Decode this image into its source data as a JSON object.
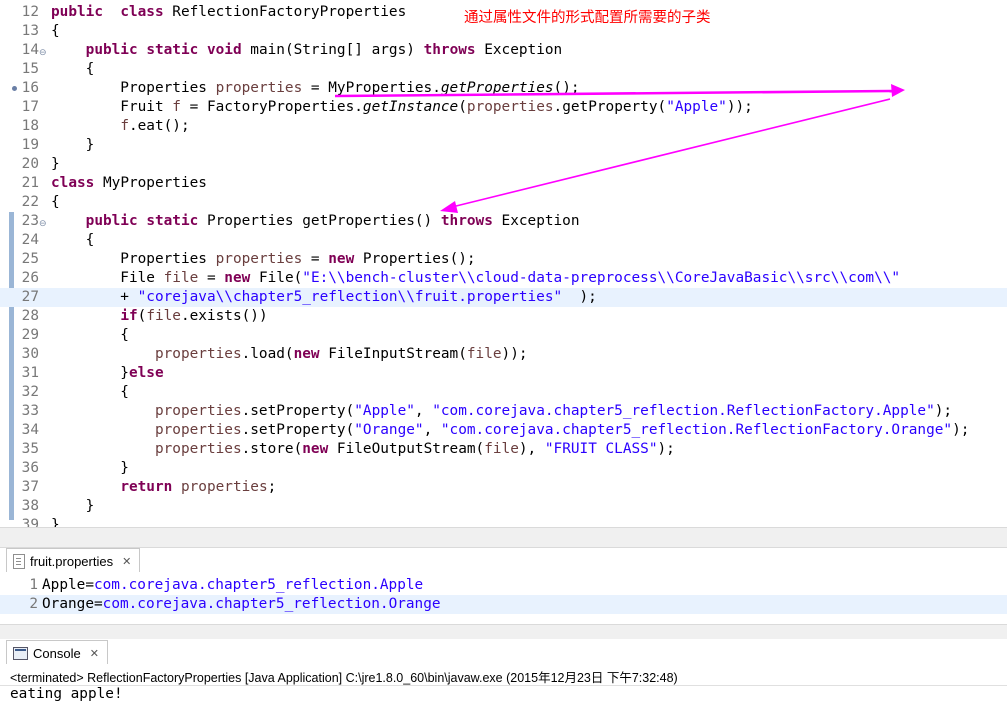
{
  "annotation": "通过属性文件的形式配置所需要的子类",
  "editor": {
    "lines": [
      {
        "num": "12",
        "segs": [
          [
            "kw",
            "public"
          ],
          [
            "",
            "  "
          ],
          [
            "kw",
            "class"
          ],
          [
            "",
            " ReflectionFactoryProperties"
          ]
        ]
      },
      {
        "num": "13",
        "segs": [
          [
            "",
            "{"
          ]
        ]
      },
      {
        "num": "14",
        "fold": true,
        "segs": [
          [
            "",
            "    "
          ],
          [
            "kw",
            "public"
          ],
          [
            "",
            " "
          ],
          [
            "kw",
            "static"
          ],
          [
            "",
            " "
          ],
          [
            "kw",
            "void"
          ],
          [
            "",
            " main(String[] args) "
          ],
          [
            "kw",
            "throws"
          ],
          [
            "",
            " Exception"
          ]
        ]
      },
      {
        "num": "15",
        "segs": [
          [
            "",
            "    {"
          ]
        ]
      },
      {
        "num": "16",
        "marker": true,
        "segs": [
          [
            "",
            "        Properties "
          ],
          [
            "fld",
            "properties"
          ],
          [
            "",
            " = MyProperties."
          ],
          [
            "it",
            "getProperties"
          ],
          [
            "",
            "();"
          ]
        ]
      },
      {
        "num": "17",
        "segs": [
          [
            "",
            "        Fruit "
          ],
          [
            "fld",
            "f"
          ],
          [
            "",
            " = FactoryProperties."
          ],
          [
            "it",
            "getInstance"
          ],
          [
            "",
            "("
          ],
          [
            "fld",
            "properties"
          ],
          [
            "",
            ".getProperty("
          ],
          [
            "str",
            "\"Apple\""
          ],
          [
            "",
            "));"
          ]
        ]
      },
      {
        "num": "18",
        "segs": [
          [
            "",
            "        "
          ],
          [
            "fld",
            "f"
          ],
          [
            "",
            ".eat();"
          ]
        ]
      },
      {
        "num": "19",
        "segs": [
          [
            "",
            "    }"
          ]
        ]
      },
      {
        "num": "20",
        "segs": [
          [
            "",
            "}"
          ]
        ]
      },
      {
        "num": "21",
        "segs": [
          [
            "kw",
            "class"
          ],
          [
            "",
            " MyProperties"
          ]
        ]
      },
      {
        "num": "22",
        "segs": [
          [
            "",
            "{"
          ]
        ]
      },
      {
        "num": "23",
        "fold": true,
        "segs": [
          [
            "",
            "    "
          ],
          [
            "kw",
            "public"
          ],
          [
            "",
            " "
          ],
          [
            "kw",
            "static"
          ],
          [
            "",
            " Properties getProperties() "
          ],
          [
            "kw",
            "throws"
          ],
          [
            "",
            " Exception"
          ]
        ]
      },
      {
        "num": "24",
        "segs": [
          [
            "",
            "    {"
          ]
        ]
      },
      {
        "num": "25",
        "segs": [
          [
            "",
            "        Properties "
          ],
          [
            "fld",
            "properties"
          ],
          [
            "",
            " = "
          ],
          [
            "kw",
            "new"
          ],
          [
            "",
            " Properties();"
          ]
        ]
      },
      {
        "num": "26",
        "segs": [
          [
            "",
            "        File "
          ],
          [
            "fld",
            "file"
          ],
          [
            "",
            " = "
          ],
          [
            "kw",
            "new"
          ],
          [
            "",
            " File("
          ],
          [
            "str",
            "\"E:\\\\bench-cluster\\\\cloud-data-preprocess\\\\CoreJavaBasic\\\\src\\\\com\\\\\""
          ]
        ]
      },
      {
        "num": "27",
        "current": true,
        "segs": [
          [
            "",
            "        + "
          ],
          [
            "str",
            "\"corejava\\\\chapter5_reflection\\\\fruit.properties\""
          ],
          [
            "",
            "  );"
          ]
        ]
      },
      {
        "num": "28",
        "segs": [
          [
            "",
            "        "
          ],
          [
            "kw",
            "if"
          ],
          [
            "",
            "("
          ],
          [
            "fld",
            "file"
          ],
          [
            "",
            ".exists())"
          ]
        ]
      },
      {
        "num": "29",
        "segs": [
          [
            "",
            "        {"
          ]
        ]
      },
      {
        "num": "30",
        "segs": [
          [
            "",
            "            "
          ],
          [
            "fld",
            "properties"
          ],
          [
            "",
            ".load("
          ],
          [
            "kw",
            "new"
          ],
          [
            "",
            " FileInputStream("
          ],
          [
            "fld",
            "file"
          ],
          [
            "",
            "));"
          ]
        ]
      },
      {
        "num": "31",
        "segs": [
          [
            "",
            "        }"
          ],
          [
            "kw",
            "else"
          ]
        ]
      },
      {
        "num": "32",
        "segs": [
          [
            "",
            "        {"
          ]
        ]
      },
      {
        "num": "33",
        "segs": [
          [
            "",
            "            "
          ],
          [
            "fld",
            "properties"
          ],
          [
            "",
            ".setProperty("
          ],
          [
            "str",
            "\"Apple\""
          ],
          [
            "",
            ", "
          ],
          [
            "str",
            "\"com.corejava.chapter5_reflection.ReflectionFactory.Apple\""
          ],
          [
            "",
            ");"
          ]
        ]
      },
      {
        "num": "34",
        "segs": [
          [
            "",
            "            "
          ],
          [
            "fld",
            "properties"
          ],
          [
            "",
            ".setProperty("
          ],
          [
            "str",
            "\"Orange\""
          ],
          [
            "",
            ", "
          ],
          [
            "str",
            "\"com.corejava.chapter5_reflection.ReflectionFactory.Orange\""
          ],
          [
            "",
            ");"
          ]
        ]
      },
      {
        "num": "35",
        "segs": [
          [
            "",
            "            "
          ],
          [
            "fld",
            "properties"
          ],
          [
            "",
            ".store("
          ],
          [
            "kw",
            "new"
          ],
          [
            "",
            " FileOutputStream("
          ],
          [
            "fld",
            "file"
          ],
          [
            "",
            "), "
          ],
          [
            "str",
            "\"FRUIT CLASS\""
          ],
          [
            "",
            ");"
          ]
        ]
      },
      {
        "num": "36",
        "segs": [
          [
            "",
            "        }"
          ]
        ]
      },
      {
        "num": "37",
        "segs": [
          [
            "",
            "        "
          ],
          [
            "kw",
            "return"
          ],
          [
            "",
            " "
          ],
          [
            "fld",
            "properties"
          ],
          [
            "",
            ";"
          ]
        ]
      },
      {
        "num": "38",
        "segs": [
          [
            "",
            "    }"
          ]
        ]
      },
      {
        "num": "39",
        "segs": [
          [
            "",
            "}"
          ]
        ]
      }
    ]
  },
  "properties_tab": {
    "title": "fruit.properties",
    "close": "✕",
    "lines": [
      {
        "num": "1",
        "key": "Apple=",
        "value": "com.corejava.chapter5_reflection.Apple"
      },
      {
        "num": "2",
        "key": "Orange=",
        "value": "com.corejava.chapter5_reflection.Orange",
        "current": true
      }
    ]
  },
  "console": {
    "title": "Console",
    "close": "✕",
    "status": "<terminated> ReflectionFactoryProperties [Java Application] C:\\jre1.8.0_60\\bin\\javaw.exe (2015年12月23日 下午7:32:48)",
    "output": "eating apple!"
  },
  "colors": {
    "keyword": "#7f0055",
    "string": "#2a00ff",
    "field": "#6a3e3e",
    "arrow": "#ff00ff",
    "annotation": "#ff0000"
  }
}
